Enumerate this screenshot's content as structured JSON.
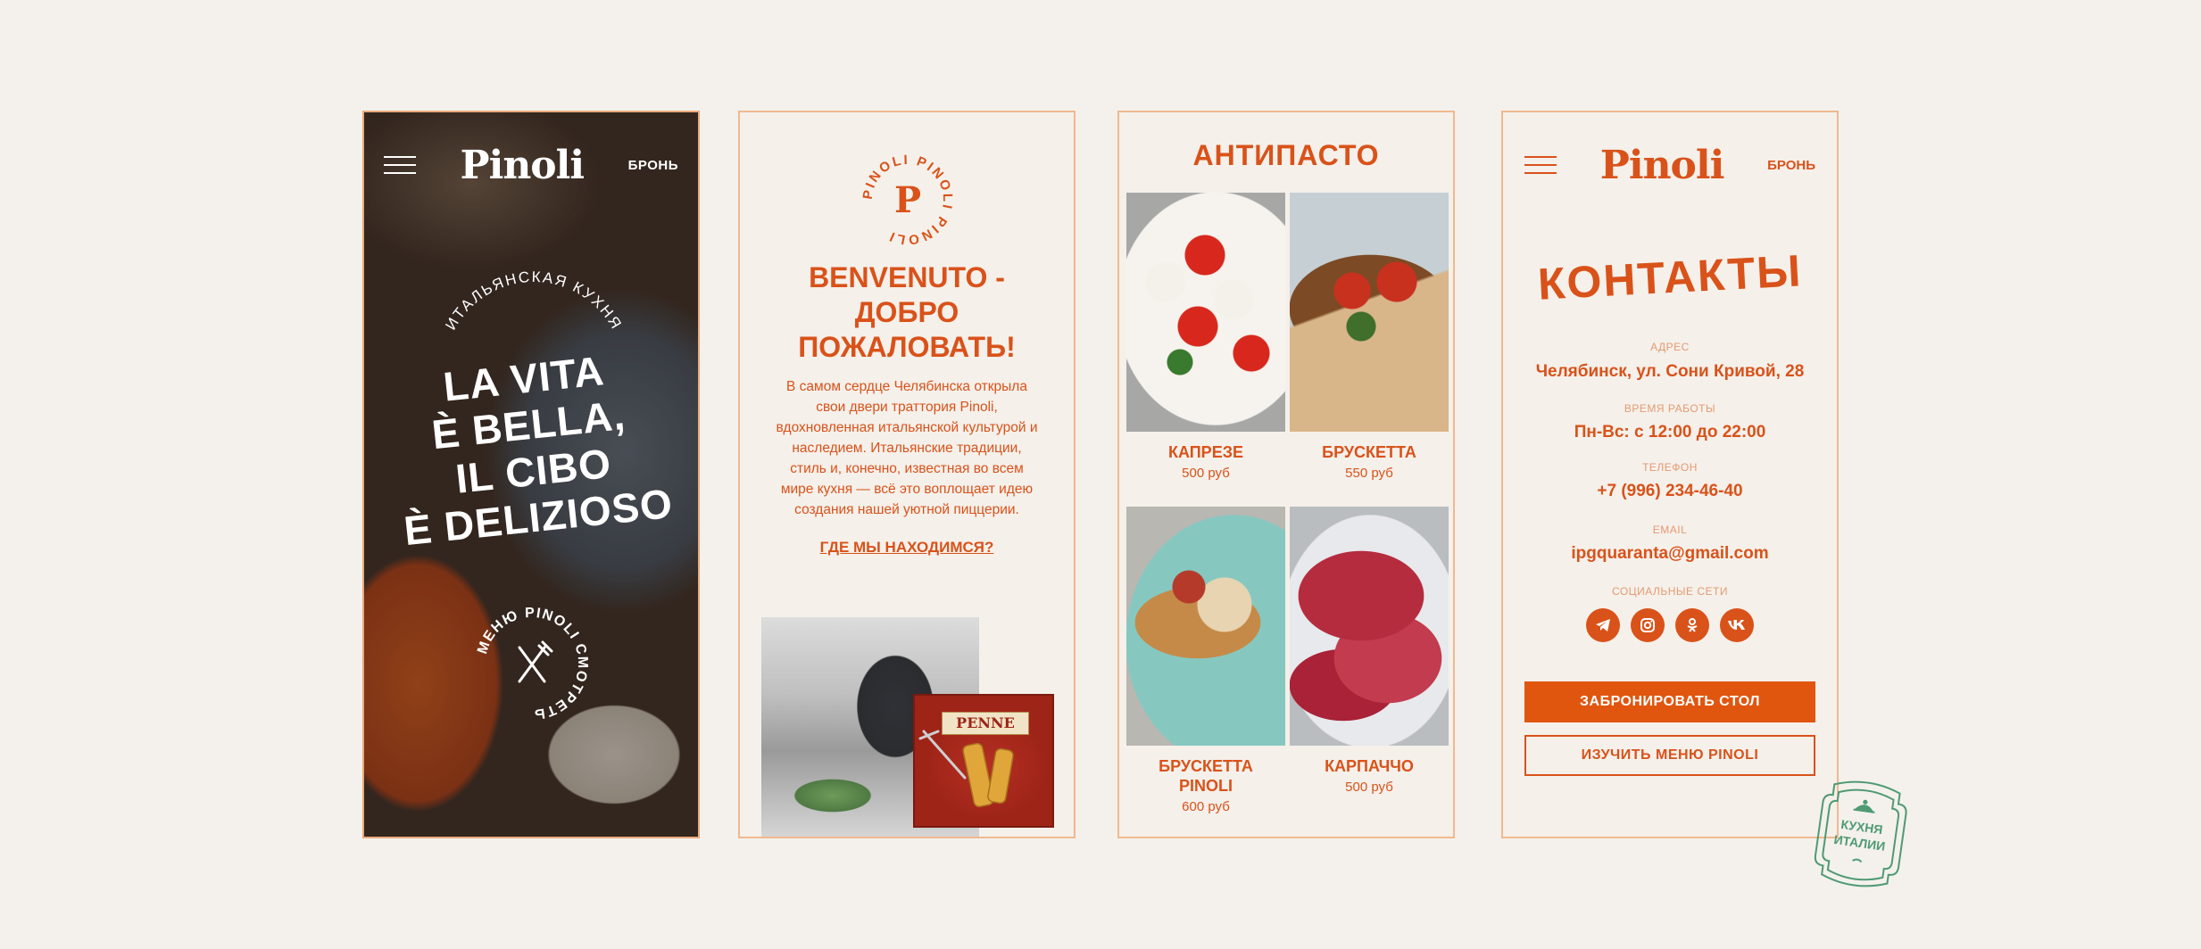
{
  "hero": {
    "menu_icon": "hamburger-icon",
    "logo": "Pinoli",
    "booking_link": "БРОНЬ",
    "arc_label": "ИТАЛЬЯНСКАЯ КУХНЯ",
    "title_lines": [
      "LA VITA",
      "È BELLA,",
      "IL CIBO",
      "È DELIZIOSO"
    ],
    "menu_badge_text": "МЕНЮ PINOLI СМОТРЕТЬ",
    "menu_badge_icon": "fork-knife-icon"
  },
  "welcome": {
    "round_logo_text": "PINOLI PINOLI PINOLI",
    "round_logo_letter": "P",
    "title_lines": [
      "BENVENUTO -",
      "ДОБРО",
      "ПОЖАЛОВАТЬ!"
    ],
    "text_lines": [
      "В самом сердце Челябинска открыла",
      "свои двери траттория Pinoli,",
      "вдохновленная итальянской культурой и",
      "наследием. Итальянские традиции,",
      "стиль и, конечно, известная во всем",
      "мире кухня — всё это воплощает идею",
      "создания нашей уютной пиццерии."
    ],
    "location_link": "ГДЕ МЫ НАХОДИМСЯ?",
    "penne_label": "PENNE"
  },
  "menu": {
    "heading": "АНТИПАСТО",
    "dishes": [
      {
        "name": "КАПРЕЗЕ",
        "price": "500 руб"
      },
      {
        "name": "БРУСКЕТТА",
        "price": "550 руб"
      },
      {
        "name": "БРУСКЕТТА PINOLI",
        "price": "600 руб"
      },
      {
        "name": "КАРПАЧЧО",
        "price": "500 руб"
      }
    ]
  },
  "contacts": {
    "logo": "Pinoli",
    "booking_link": "БРОНЬ",
    "title": "КОНТАКТЫ",
    "address_label": "АДРЕС",
    "address": "Челябинск, ул. Сони Кривой, 28",
    "hours_label": "ВРЕМЯ РАБОТЫ",
    "hours": "Пн-Вс: с 12:00 до 22:00",
    "phone_label": "ТЕЛЕФОН",
    "phone": "+7 (996) 234-46-40",
    "email_label": "EMAIL",
    "email": "ipgquaranta@gmail.com",
    "social_label": "СОЦИАЛЬНЫЕ СЕТИ",
    "socials": [
      "telegram-icon",
      "instagram-icon",
      "odnoklassniki-icon",
      "vk-icon"
    ],
    "book_button": "ЗАБРОНИРОВАТЬ СТОЛ",
    "menu_button": "ИЗУЧИТЬ МЕНЮ PINOLI"
  },
  "stamp": {
    "line1": "КУХНЯ",
    "line2": "ИТАЛИИ",
    "icon": "cloche-icon"
  },
  "colors": {
    "accent": "#d9521a",
    "button": "#e0560f",
    "background": "#f4f1ec",
    "panel_border": "#f0b98e",
    "stamp": "#4f9a74"
  }
}
